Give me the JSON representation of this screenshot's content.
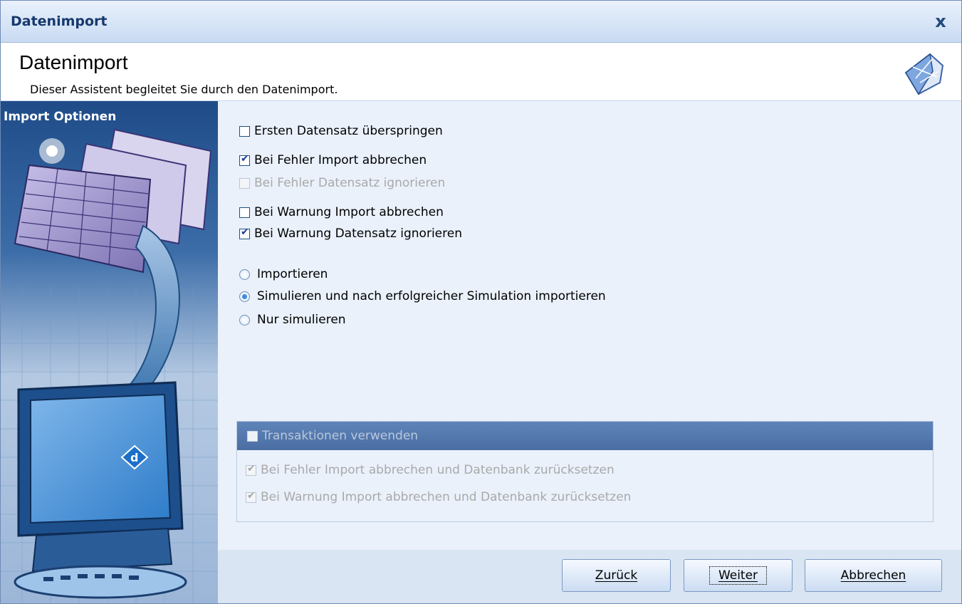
{
  "window": {
    "title": "Datenimport",
    "close_glyph": "x"
  },
  "header": {
    "title": "Datenimport",
    "subtitle": "Dieser Assistent begleitet Sie durch den Datenimport."
  },
  "sidebar": {
    "title": "Import Optionen"
  },
  "options": {
    "skip_first": {
      "label": "Ersten Datensatz überspringen",
      "checked": false,
      "enabled": true
    },
    "error_abort": {
      "label": "Bei Fehler Import abbrechen",
      "checked": true,
      "enabled": true
    },
    "error_ignore": {
      "label": "Bei Fehler Datensatz ignorieren",
      "checked": false,
      "enabled": false
    },
    "warning_abort": {
      "label": "Bei Warnung Import abbrechen",
      "checked": false,
      "enabled": true
    },
    "warning_ignore": {
      "label": "Bei Warnung Datensatz ignorieren",
      "checked": true,
      "enabled": true
    }
  },
  "mode": {
    "import": {
      "label": "Importieren",
      "selected": false
    },
    "simulate_then_import": {
      "label": "Simulieren und nach erfolgreicher Simulation importieren",
      "selected": true
    },
    "simulate_only": {
      "label": "Nur simulieren",
      "selected": false
    }
  },
  "transactions": {
    "header_label": "Transaktionen verwenden",
    "header_checked": false,
    "error_reset": {
      "label": "Bei Fehler Import abbrechen und Datenbank zurücksetzen",
      "checked": true,
      "enabled": false
    },
    "warning_reset": {
      "label": "Bei Warnung Import abbrechen und Datenbank zurücksetzen",
      "checked": true,
      "enabled": false
    }
  },
  "buttons": {
    "back": "Zurück",
    "next": "Weiter",
    "cancel": "Abbrechen"
  },
  "icons": {
    "close": "close-icon",
    "wizard": "wizard-logo-icon",
    "illustration": "import-illustration"
  },
  "colors": {
    "titlebar_text": "#16386d",
    "sidebar_top": "#1f4c88",
    "group_header": "#5f84b9",
    "radio_selected": "#3d8ce0"
  }
}
